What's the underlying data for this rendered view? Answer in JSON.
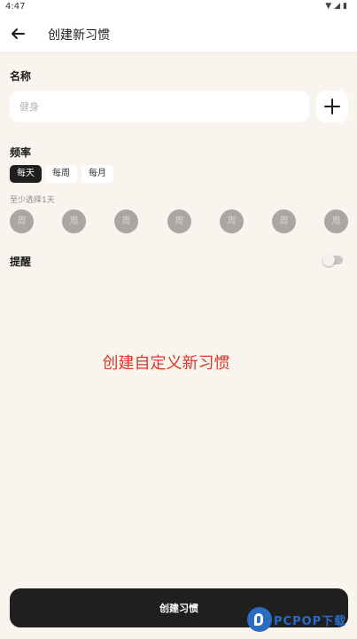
{
  "status_bar": {
    "time": "4:47"
  },
  "app_bar": {
    "title": "创建新习惯"
  },
  "name_section": {
    "label": "名称",
    "placeholder": "健身"
  },
  "frequency_section": {
    "label": "频率",
    "tabs": [
      {
        "label": "每天",
        "selected": true
      },
      {
        "label": "每周",
        "selected": false
      },
      {
        "label": "每月",
        "selected": false
      }
    ],
    "hint": "至少选择1天",
    "days": [
      "周",
      "周",
      "周",
      "周",
      "周",
      "周",
      "周"
    ]
  },
  "reminder_section": {
    "label": "提醒",
    "enabled": false
  },
  "overlay_caption": "创建自定义新习惯",
  "create_button": {
    "label": "创建习惯"
  },
  "watermark": {
    "text": "PCPOP下载"
  },
  "colors": {
    "background": "#faf4ee",
    "primary": "#1f1f1f",
    "caption": "#d9382b",
    "day_circle": "#a9a6a3"
  }
}
